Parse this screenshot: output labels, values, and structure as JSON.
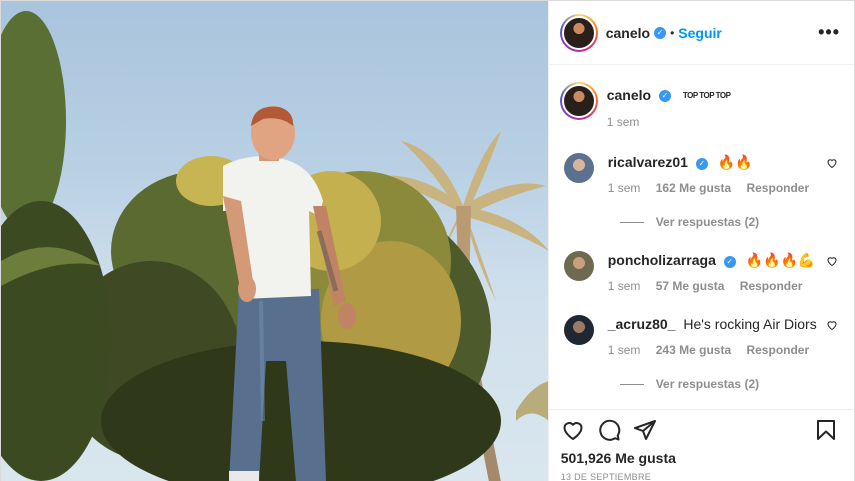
{
  "post": {
    "username": "canelo",
    "verified_mark": "✓",
    "follow_separator": "•",
    "follow_label": "Seguir",
    "more_label": "•••"
  },
  "caption": {
    "username": "canelo",
    "text": "TOP TOP TOP",
    "time": "1 sem"
  },
  "comments": [
    {
      "username": "ricalvarez01",
      "verified": true,
      "text": "🔥🔥",
      "time": "1 sem",
      "likes": "162 Me gusta",
      "reply_label": "Responder",
      "view_replies": "Ver respuestas (2)"
    },
    {
      "username": "poncholizarraga",
      "verified": true,
      "text": "🔥🔥🔥💪",
      "time": "1 sem",
      "likes": "57 Me gusta",
      "reply_label": "Responder"
    },
    {
      "username": "_acruz80_",
      "verified": false,
      "text": "He's rocking Air Diors",
      "time": "1 sem",
      "likes": "243 Me gusta",
      "reply_label": "Responder",
      "view_replies": "Ver respuestas (2)"
    }
  ],
  "footer": {
    "likes": "501,926 Me gusta",
    "date": "13 DE SEPTIEMBRE"
  },
  "icons": [
    "heart-icon",
    "comment-icon",
    "share-icon",
    "bookmark-icon",
    "more-icon",
    "verified-icon"
  ],
  "colors": {
    "accent": "#0095f6",
    "verified": "#3897f0",
    "muted": "#8e8e8e",
    "text": "#262626"
  }
}
